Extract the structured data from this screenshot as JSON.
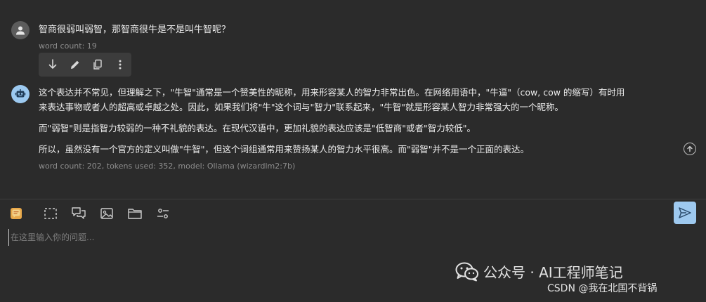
{
  "user_message": {
    "text": "智商很弱叫弱智，那智商很牛是不是叫牛智呢？",
    "meta": "word count: 19"
  },
  "message_toolbar": {
    "icons": [
      "download-icon",
      "edit-icon",
      "copy-icon",
      "more-vertical-icon"
    ]
  },
  "bot_message": {
    "paragraphs": [
      "这个表达并不常见，但理解之下，\"牛智\"通常是一个赞美性的昵称，用来形容某人的智力非常出色。在网络用语中，\"牛逼\"（cow, cow 的缩写）有时用",
      "来表达事物或者人的超高或卓越之处。因此，如果我们将\"牛\"这个词与\"智力\"联系起来，\"牛智\"就是形容某人智力非常强大的一个昵称。",
      "而\"弱智\"则是指智力较弱的一种不礼貌的表达。在现代汉语中，更加礼貌的表达应该是\"低智商\"或者\"智力较低\"。",
      "所以，虽然没有一个官方的定义叫做\"牛智\"，但这个词组通常用来赞扬某人的智力水平很高。而\"弱智\"并不是一个正面的表达。"
    ],
    "meta": "word count: 202, tokens used: 352, model: Ollama (wizardlm2:7b)"
  },
  "input": {
    "placeholder": "在这里输入你的问题...",
    "value": "",
    "tools": [
      "sticker-icon",
      "screenshot-icon",
      "chat-bubbles-icon",
      "image-icon",
      "folder-icon",
      "settings-sliders-icon"
    ]
  },
  "watermark": {
    "line1": "公众号 · AI工程师笔记",
    "line2": "CSDN @我在北国不背锅"
  },
  "colors": {
    "background": "#2b2b2b",
    "toolbar": "#3c3c3c",
    "accent": "#9ec9ef",
    "meta_text": "#8d8d8d"
  }
}
